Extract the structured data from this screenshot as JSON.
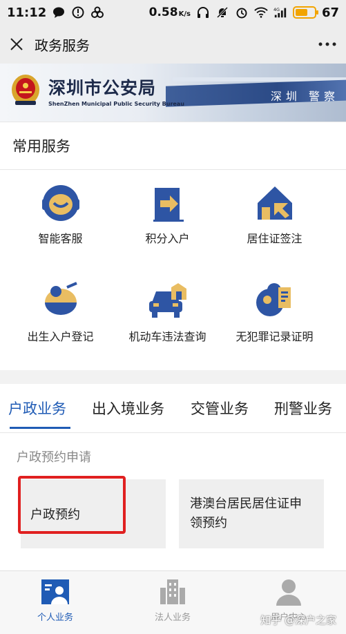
{
  "status_bar": {
    "time": "11:12",
    "net_speed": "0.58",
    "net_unit": "K/s",
    "network": "4G",
    "battery": "67",
    "battery_level": 0.67,
    "icons": [
      "chat-bubble-icon",
      "notification-icon",
      "link-icon",
      "headphones-icon",
      "mute-icon",
      "alarm-icon",
      "wifi-icon",
      "signal-icon"
    ]
  },
  "nav": {
    "title": "政务服务",
    "close_icon": "close-icon",
    "more_icon": "more-icon"
  },
  "banner": {
    "name": "深圳市公安局",
    "subtitle": "ShenZhen Municipal Public Security Bureau",
    "photo_text": "深圳 警察"
  },
  "common_services": {
    "title": "常用服务",
    "items": [
      {
        "label": "智能客服",
        "icon": "customer-service-icon"
      },
      {
        "label": "积分入户",
        "icon": "points-household-icon"
      },
      {
        "label": "居住证签注",
        "icon": "residence-permit-icon"
      },
      {
        "label": "出生入户登记",
        "icon": "birth-registration-icon"
      },
      {
        "label": "机动车违法查询",
        "icon": "vehicle-violation-icon"
      },
      {
        "label": "无犯罪记录证明",
        "icon": "no-criminal-record-icon"
      }
    ]
  },
  "tabs": [
    {
      "label": "户政业务",
      "active": true
    },
    {
      "label": "出入境业务",
      "active": false
    },
    {
      "label": "交管业务",
      "active": false
    },
    {
      "label": "刑警业务",
      "active": false
    }
  ],
  "section": {
    "title": "户政预约申请",
    "cards": [
      {
        "label": "户政预约"
      },
      {
        "label_line1": "港澳台居民居住证申",
        "label_line2": "领预约"
      }
    ]
  },
  "bottom_nav": [
    {
      "label": "个人业务",
      "icon": "personal-business-icon",
      "active": true
    },
    {
      "label": "法人业务",
      "icon": "corporate-business-icon",
      "active": false
    },
    {
      "label": "用户中心",
      "icon": "user-center-icon",
      "active": false
    }
  ],
  "watermark": "知乎 @深户之家",
  "colors": {
    "accent": "#1f5bb5",
    "highlight": "#e02020",
    "icon_blue": "#2e55a4",
    "icon_gold": "#e9bd62"
  }
}
